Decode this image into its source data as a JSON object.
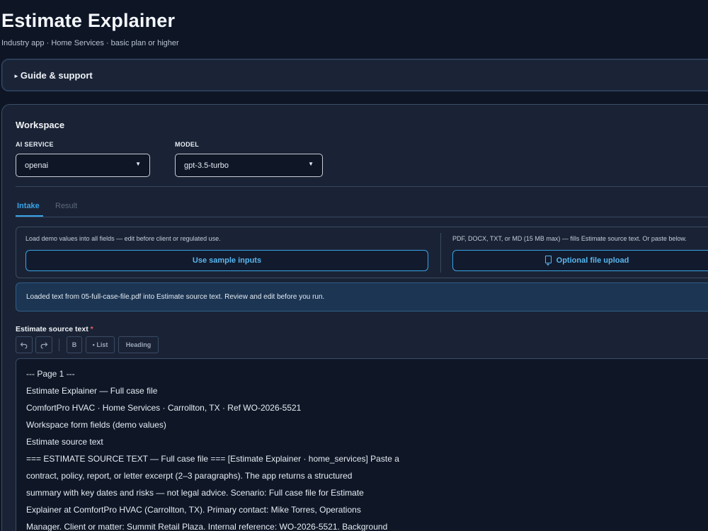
{
  "header": {
    "title": "Estimate Explainer",
    "subtitle": "Industry app · Home Services · basic plan or higher"
  },
  "guide": {
    "label": "Guide & support"
  },
  "workspace": {
    "title": "Workspace",
    "ai_service": {
      "label": "AI SERVICE",
      "value": "openai"
    },
    "model": {
      "label": "MODEL",
      "value": "gpt-3.5-turbo"
    },
    "tabs": [
      {
        "label": "Intake",
        "active": true
      },
      {
        "label": "Result",
        "active": false
      }
    ],
    "sample": {
      "hint": "Load demo values into all fields — edit before client or regulated use.",
      "button": "Use sample inputs"
    },
    "upload": {
      "hint": "PDF, DOCX, TXT, or MD (15 MB max) — fills Estimate source text. Or paste below.",
      "button": "Optional file upload",
      "icon": "file-upload-icon"
    },
    "notice": "Loaded text from 05-full-case-file.pdf into Estimate source text. Review and edit before you run.",
    "source": {
      "label": "Estimate source text",
      "required_mark": "*",
      "toolbar": {
        "undo_icon": "undo-icon",
        "redo_icon": "redo-icon",
        "bold": "B",
        "list": "• List",
        "heading": "Heading"
      },
      "lines": [
        "--- Page 1 ---",
        "Estimate Explainer — Full case file",
        "ComfortPro HVAC · Home Services · Carrollton, TX · Ref WO-2026-5521",
        "Workspace form fields (demo values)",
        "Estimate source text",
        "=== ESTIMATE SOURCE TEXT — Full case file === [Estimate Explainer · home_services] Paste a",
        "contract, policy, report, or letter excerpt (2–3 paragraphs). The app returns a structured",
        "summary with key dates and risks — not legal advice. Scenario: Full case file for Estimate",
        "Explainer at ComfortPro HVAC (Carrollton, TX). Primary contact: Mike Torres, Operations",
        "Manager. Client or matter: Summit Retail Plaza. Internal reference: WO-2026-5521. Background"
      ]
    }
  },
  "colors": {
    "background": "#0e1626",
    "panel": "#1a2335",
    "accent": "#3aa3e6",
    "notice": "#1c3552",
    "required": "#f25b5b"
  }
}
